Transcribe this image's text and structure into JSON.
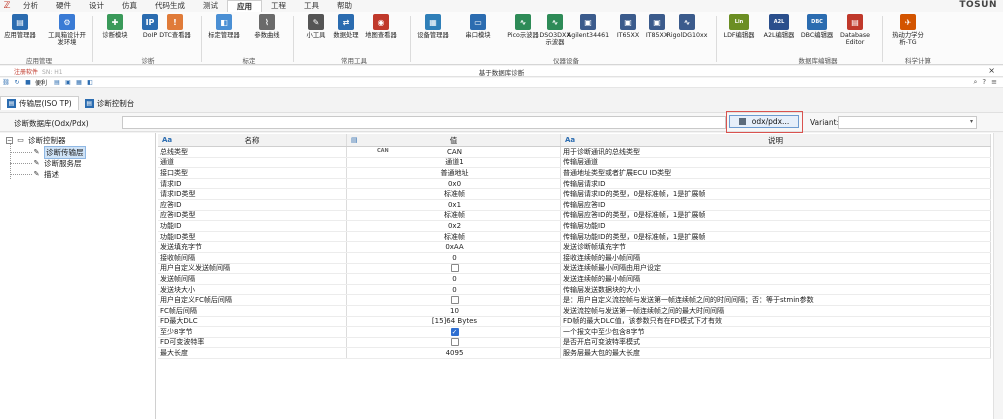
{
  "menubar": {
    "items": [
      "分析",
      "硬件",
      "设计",
      "仿真",
      "代码生成",
      "测试",
      "应用",
      "工程",
      "工具",
      "帮助"
    ],
    "active_index": 6,
    "brand": "TOSUN"
  },
  "ribbon": {
    "buttons": [
      {
        "label": "应用管理器",
        "icon": "app-manager-icon",
        "color": "#2b6cb0",
        "glyph": "▤"
      },
      {
        "label": "工具箱设计开发环境",
        "icon": "toolbox-icon",
        "color": "#3a7bd5",
        "glyph": "⚙"
      },
      {
        "label": "诊断模块",
        "icon": "diagnostic-module-icon",
        "color": "#3a9a5a",
        "glyph": "✚"
      },
      {
        "label": "DoIP",
        "icon": "doip-icon",
        "color": "#2b6cb0",
        "glyph": "IP"
      },
      {
        "label": "DTC查看器",
        "icon": "dtc-viewer-icon",
        "color": "#e07b39",
        "glyph": "!"
      },
      {
        "label": "标定管理器",
        "icon": "calibration-manager-icon",
        "color": "#4a8fd4",
        "glyph": "◧"
      },
      {
        "label": "参数曲线",
        "icon": "parameter-curve-icon",
        "color": "#6a6a6a",
        "glyph": "⌇"
      },
      {
        "label": "小工具",
        "icon": "tools-icon",
        "color": "#555",
        "glyph": "✎"
      },
      {
        "label": "数据处理",
        "icon": "data-processing-icon",
        "color": "#2b6cb0",
        "glyph": "⇄"
      },
      {
        "label": "地图查看器",
        "icon": "map-viewer-icon",
        "color": "#c0392b",
        "glyph": "◉"
      },
      {
        "label": "设备管理器",
        "icon": "device-manager-icon",
        "color": "#2f7fb8",
        "glyph": "▦"
      },
      {
        "label": "串口模块",
        "icon": "serial-port-icon",
        "color": "#2b6cb0",
        "glyph": "▭"
      },
      {
        "label": "Pico示波器",
        "icon": "pico-scope-icon",
        "color": "#2e8b57",
        "glyph": "∿"
      },
      {
        "label": "DSO3DXX示波器",
        "icon": "dso-scope-icon",
        "color": "#2e8b57",
        "glyph": "∿"
      },
      {
        "label": "Agilent34461",
        "icon": "agilent-icon",
        "color": "#3b5b8c",
        "glyph": "▣"
      },
      {
        "label": "IT65XX",
        "icon": "it65xx-icon",
        "color": "#3b5b8c",
        "glyph": "▣"
      },
      {
        "label": "IT85XX",
        "icon": "it85xx-icon",
        "color": "#3b5b8c",
        "glyph": "▣"
      },
      {
        "label": "RigolDG10xx",
        "icon": "rigol-icon",
        "color": "#3b5b8c",
        "glyph": "∿"
      },
      {
        "label": "LDF编辑器",
        "icon": "ldf-editor-icon",
        "color": "#6b8e23",
        "glyph": "Lin"
      },
      {
        "label": "A2L编辑器",
        "icon": "a2l-editor-icon",
        "color": "#2b4f8c",
        "glyph": "A2L"
      },
      {
        "label": "DBC编辑器",
        "icon": "dbc-editor-icon",
        "color": "#2b6cb0",
        "glyph": "DBC"
      },
      {
        "label": "Database Editor",
        "icon": "database-editor-icon",
        "color": "#c0392b",
        "glyph": "▤"
      },
      {
        "label": "热动力学分析-TG",
        "icon": "thermo-analysis-icon",
        "color": "#d35400",
        "glyph": "✈"
      }
    ],
    "groups": [
      "应用管理",
      "诊断",
      "标定",
      "常用工具",
      "仪器设备",
      "数据库编辑器",
      "科学计算"
    ]
  },
  "window": {
    "left_label": "注册软件",
    "left_sublabel": "SN: H1",
    "title": "基于数据库诊断",
    "close": "×"
  },
  "quick_toolbar": {
    "label": "便利"
  },
  "tabs": [
    {
      "label": "传输层(ISO TP)",
      "icon": "transport-layer-icon",
      "active": true
    },
    {
      "label": "诊断控制台",
      "icon": "diagnostic-console-icon",
      "active": false
    }
  ],
  "database": {
    "label": "诊断数据库(Odx/Pdx)",
    "path_value": "",
    "odx_button": "odx/pdx...",
    "variant_label": "Variant:",
    "variant_value": ""
  },
  "tree": {
    "root": "诊断控制器",
    "children": [
      "诊断传输层",
      "诊断服务层",
      "描述"
    ],
    "selected_index": 0
  },
  "grid": {
    "headers": [
      "名称",
      "值",
      "说明"
    ],
    "rows": [
      {
        "name": "总线类型",
        "value": "CAN",
        "type": "CAN",
        "desc": "用于诊断通讯的总线类型"
      },
      {
        "name": "通道",
        "value": "通道1",
        "desc": "传输层通道"
      },
      {
        "name": "接口类型",
        "value": "普通地址",
        "desc": "普通地址类型或者扩展ECU ID类型"
      },
      {
        "name": "请求ID",
        "value": "0x0",
        "desc": "传输层请求ID"
      },
      {
        "name": "请求ID类型",
        "value": "标准帧",
        "desc": "传输层请求ID的类型，0是标准帧，1是扩展帧"
      },
      {
        "name": "应答ID",
        "value": "0x1",
        "desc": "传输层应答ID"
      },
      {
        "name": "应答ID类型",
        "value": "标准帧",
        "desc": "传输层应答ID的类型，0是标准帧，1是扩展帧"
      },
      {
        "name": "功能ID",
        "value": "0x2",
        "desc": "传输层功能ID"
      },
      {
        "name": "功能ID类型",
        "value": "标准帧",
        "desc": "传输层功能ID的类型，0是标准帧，1是扩展帧"
      },
      {
        "name": "发送填充字节",
        "value": "0xAA",
        "desc": "发送诊断帧填充字节"
      },
      {
        "name": "接收帧间隔",
        "value": "0",
        "desc": "接收连续帧的最小帧间隔"
      },
      {
        "name": "用户自定义发送帧间隔",
        "checkbox": false,
        "desc": "发送连续帧最小间隔由用户设定"
      },
      {
        "name": "发送帧间隔",
        "value": "0",
        "desc": "发送连续帧的最小帧间隔"
      },
      {
        "name": "发送块大小",
        "value": "0",
        "desc": "传输层发送数据块的大小"
      },
      {
        "name": "用户自定义FC帧后间隔",
        "checkbox": false,
        "desc": "是：用户自定义流控帧与发送第一帧连续帧之间的时间间隔；否：等于stmin参数"
      },
      {
        "name": "FC帧后间隔",
        "value": "10",
        "desc": "发送流控帧与发送第一帧连续帧之间的最大时间间隔"
      },
      {
        "name": "FD最大DLC",
        "value": "[15]64 Bytes",
        "desc": "FD帧的最大DLC值，该参数只有在FD模式下才有效"
      },
      {
        "name": "至少8字节",
        "checkbox": true,
        "desc": "一个报文中至少包含8字节"
      },
      {
        "name": "FD可变波特率",
        "checkbox": false,
        "desc": "是否开启可变波特率模式"
      },
      {
        "name": "最大长度",
        "value": "4095",
        "desc": "服务层最大包的最大长度"
      }
    ]
  }
}
